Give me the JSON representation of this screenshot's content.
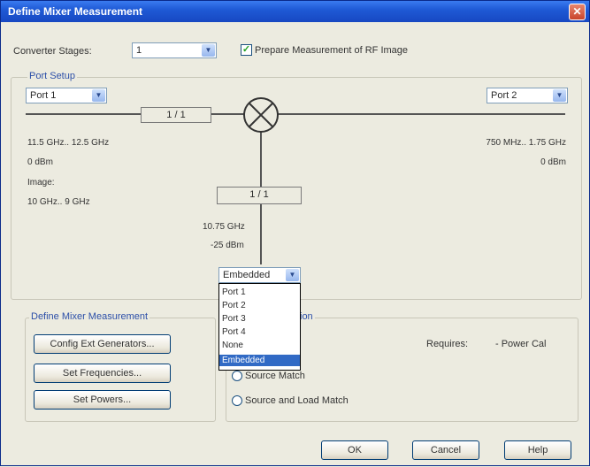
{
  "window": {
    "title": "Define Mixer Measurement",
    "close_glyph": "✕"
  },
  "converter": {
    "label": "Converter Stages:",
    "value": "1"
  },
  "prepare": {
    "checked": true,
    "label": "Prepare Measurement of RF Image"
  },
  "port_setup": {
    "label": "Port Setup",
    "left_port": "Port 1",
    "right_port": "Port 2",
    "ratio_top": "1 / 1",
    "ratio_bottom": "1 / 1",
    "left_freq": "11.5 GHz.. 12.5 GHz",
    "left_power": "0 dBm",
    "image_label": "Image:",
    "image_freq": "10 GHz.. 9 GHz",
    "right_freq": "750 MHz.. 1.75 GHz",
    "right_power": "0 dBm",
    "lo_freq": "10.75 GHz",
    "lo_power": "-25 dBm",
    "lo_port": "Embedded",
    "lo_options": [
      "Port 1",
      "Port 2",
      "Port 3",
      "Port 4",
      "None",
      "Embedded"
    ]
  },
  "define_group": {
    "label": "Define Mixer Measurement",
    "buttons": [
      "Config Ext Generators...",
      "Set Frequencies...",
      "Set Powers..."
    ]
  },
  "calibration_group": {
    "label_tail": "ion",
    "requires_label": "Requires:",
    "requires_value": "- Power Cal",
    "option1_partial": "Source Match",
    "option2": "Source and Load Match"
  },
  "footer": {
    "ok": "OK",
    "cancel": "Cancel",
    "help": "Help"
  }
}
